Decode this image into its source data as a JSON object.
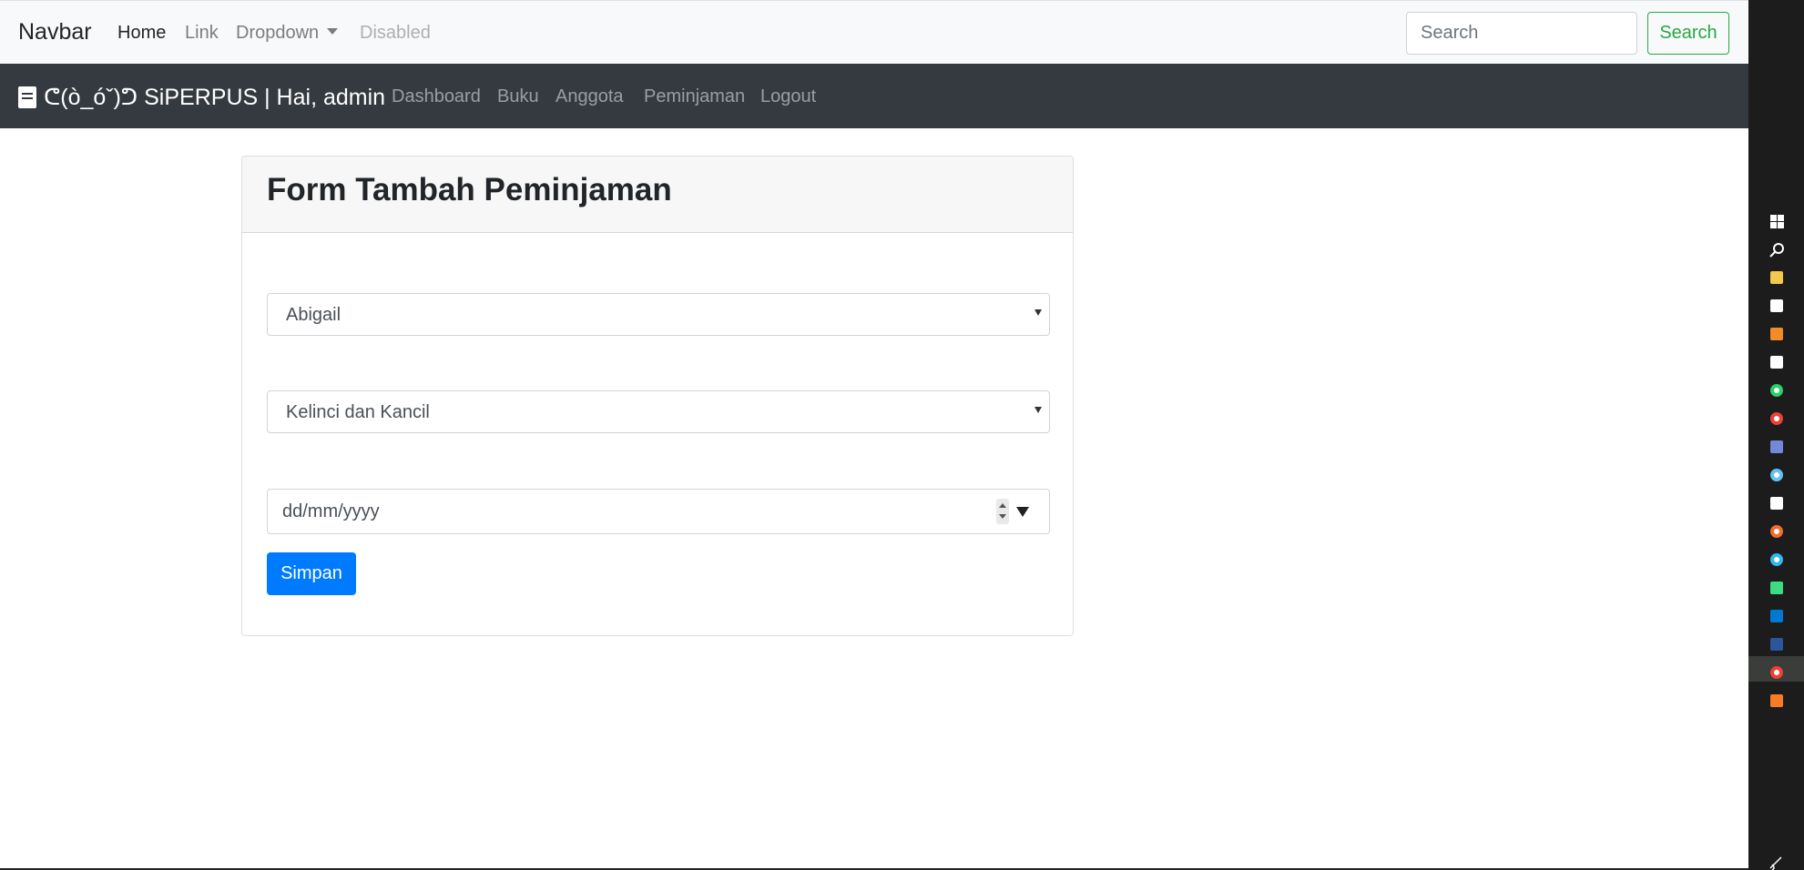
{
  "navbar": {
    "brand": "Navbar",
    "links": [
      "Home",
      "Link",
      "Dropdown",
      "Disabled"
    ],
    "search_placeholder": "Search",
    "search_button": "Search"
  },
  "appbar": {
    "brand": "ᕦ(ò_óˇ)ᕤ SiPERPUS | Hai, admin",
    "links": [
      "Dashboard",
      "Buku",
      "Anggota",
      "Peminjaman",
      "Logout"
    ]
  },
  "form": {
    "title": "Form Tambah Peminjaman",
    "member_select": "Abigail",
    "book_select": "Kelinci dan Kancil",
    "date_placeholder": "dd/mm/yyyy",
    "submit": "Simpan"
  },
  "taskbar": {
    "icons": [
      {
        "name": "windows-icon",
        "color": "#ffffff"
      },
      {
        "name": "search-icon",
        "color": "#ffffff"
      },
      {
        "name": "file-explorer-icon",
        "color": "#f2c94c"
      },
      {
        "name": "security-icon",
        "color": "#ffffff"
      },
      {
        "name": "sublime-text-icon",
        "color": "#f28c28"
      },
      {
        "name": "camera-icon",
        "color": "#ffffff"
      },
      {
        "name": "whatsapp-icon",
        "color": "#25d366"
      },
      {
        "name": "chrome-icon",
        "color": "#ea4335"
      },
      {
        "name": "discord-icon",
        "color": "#7289da"
      },
      {
        "name": "steam-icon",
        "color": "#66c0f4"
      },
      {
        "name": "epic-games-icon",
        "color": "#ffffff"
      },
      {
        "name": "origin-icon",
        "color": "#f56c2d"
      },
      {
        "name": "browser-icon",
        "color": "#30b8f0"
      },
      {
        "name": "android-icon",
        "color": "#3ddc84"
      },
      {
        "name": "vscode-icon",
        "color": "#0078d4"
      },
      {
        "name": "word-icon",
        "color": "#2b579a"
      },
      {
        "name": "chrome-active-icon",
        "color": "#ea4335"
      },
      {
        "name": "xampp-icon",
        "color": "#fb7a24"
      },
      {
        "name": "pen-icon",
        "color": "#ffffff"
      }
    ]
  }
}
